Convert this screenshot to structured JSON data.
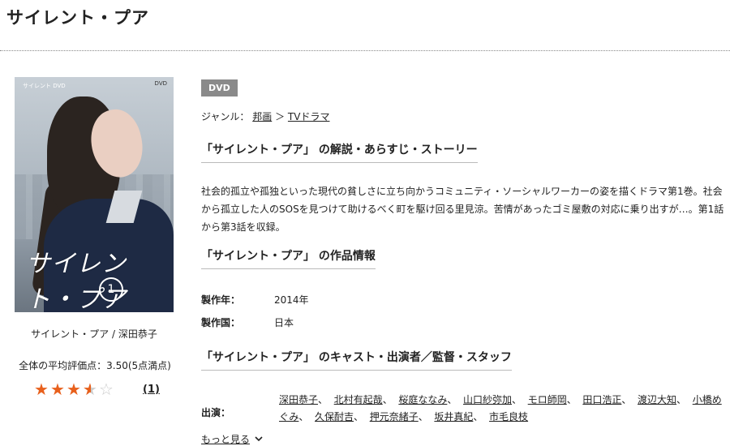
{
  "page": {
    "title": "サイレント・プア"
  },
  "cover": {
    "logo_text": "サイレント・プア",
    "disc_text": "1",
    "top_left": "サイレント DVD",
    "top_right": "DVD",
    "caption": "サイレント・プア / 深田恭子"
  },
  "rating": {
    "avg_text": "全体の平均評価点：3.50(5点満点)",
    "value": 3.5,
    "max": 5,
    "count_text": "(1)",
    "star_color": "#e8601c"
  },
  "badge": {
    "label": "DVD"
  },
  "genre": {
    "prefix": "ジャンル：",
    "link1": "邦画",
    "separator": "＞",
    "link2": "TVドラマ"
  },
  "synopsis": {
    "heading": "「サイレント・プア」 の解説・あらすじ・ストーリー",
    "body": "社会的孤立や孤独といった現代の貧しさに立ち向かうコミュニティ・ソーシャルワーカーの姿を描くドラマ第1巻。社会から孤立した人のSOSを見つけて助けるべく町を駆け回る里見涼。苦情があったゴミ屋敷の対応に乗り出すが…。第1話から第3話を収録。"
  },
  "info": {
    "heading": "「サイレント・プア」 の作品情報",
    "rows": [
      {
        "label": "製作年：",
        "value": "2014年"
      },
      {
        "label": "製作国：",
        "value": "日本"
      }
    ]
  },
  "cast": {
    "heading": "「サイレント・プア」 のキャスト・出演者／監督・スタッフ",
    "label": "出演：",
    "names": [
      "深田恭子",
      "北村有起哉",
      "桜庭ななみ",
      "山口紗弥加",
      "モロ師岡",
      "田口浩正",
      "渡辺大知",
      "小橋めぐみ",
      "久保酎吉",
      "押元奈緒子",
      "坂井真紀",
      "市毛良枝"
    ],
    "sep": "、",
    "more_label": "もっと見る",
    "more_icon": "chevron-down-icon"
  }
}
